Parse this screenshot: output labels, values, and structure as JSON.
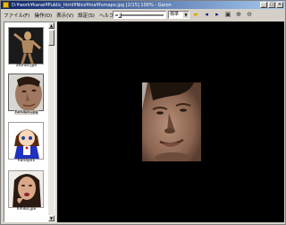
{
  "window": {
    "title": "D:¥work¥kanai¥Public_html¥Nico¥ma¥fumapo.jpg  [2/15] 100% - Garon",
    "controls": {
      "minimize": "_",
      "maximize": "□",
      "close": "×"
    }
  },
  "menu": [
    "ファイル(F)",
    "操作(O)",
    "表示(V)",
    "設定(S)",
    "ヘルプ(H)"
  ],
  "toolbar": {
    "zoom_value": "標準",
    "buttons": [
      "folder-icon",
      "prev-icon",
      "next-icon",
      "zoom-fit-icon",
      "zoom-in-icon",
      "zoom-out-icon"
    ]
  },
  "thumbnails": [
    {
      "filename": "afonso.jpe",
      "selected": false
    },
    {
      "filename": "fumapo.jpg",
      "selected": true
    },
    {
      "filename": "hanayo1",
      "selected": false
    },
    {
      "filename": "hihiko.jpe",
      "selected": false
    }
  ],
  "colors": {
    "viewer_bg": "#000000",
    "title_start": "#0a246a",
    "title_end": "#a6caf0",
    "chrome": "#d4d0c8"
  }
}
